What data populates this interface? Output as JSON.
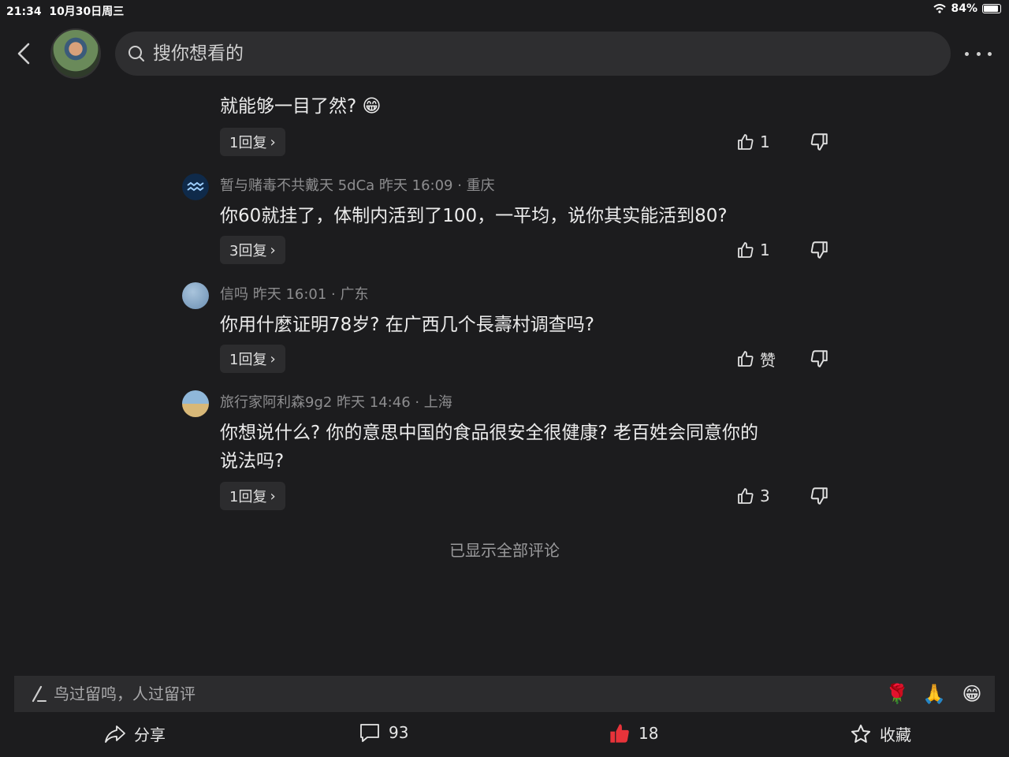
{
  "status": {
    "time": "21:34",
    "date": "10月30日周三",
    "battery": "84%",
    "battery_level": 0.84
  },
  "search": {
    "placeholder": "搜你想看的"
  },
  "comments": [
    {
      "text": "就能够一目了然?",
      "emoji": "😁",
      "replies": "1回复",
      "likes": "1"
    },
    {
      "meta": "暂与赌毒不共戴天 5dCa  昨天 16:09 · 重庆",
      "text": "你60就挂了，体制内活到了100，一平均，说你其实能活到80?",
      "replies": "3回复",
      "likes": "1"
    },
    {
      "meta": "信吗  昨天 16:01 · 广东",
      "text": "你用什麼证明78岁? 在广西几个長壽村调查吗?",
      "replies": "1回复",
      "likes": "赞"
    },
    {
      "meta": "旅行家阿利森9g2  昨天 14:46 · 上海",
      "text_line1": "你想说什么? 你的意思中国的食品很安全很健康? 老百姓会同意你的",
      "text_line2": "说法吗?",
      "replies": "1回复",
      "likes": "3"
    }
  ],
  "all_shown": "已显示全部评论",
  "composer": {
    "placeholder": "鸟过留鸣，人过留评",
    "emojis": [
      "🌹",
      "🙏",
      "😁"
    ]
  },
  "bottom": {
    "share": "分享",
    "comments": "93",
    "likes": "18",
    "favorite": "收藏"
  },
  "colors": {
    "background": "#1c1c1e",
    "like_red": "#e8333a"
  }
}
